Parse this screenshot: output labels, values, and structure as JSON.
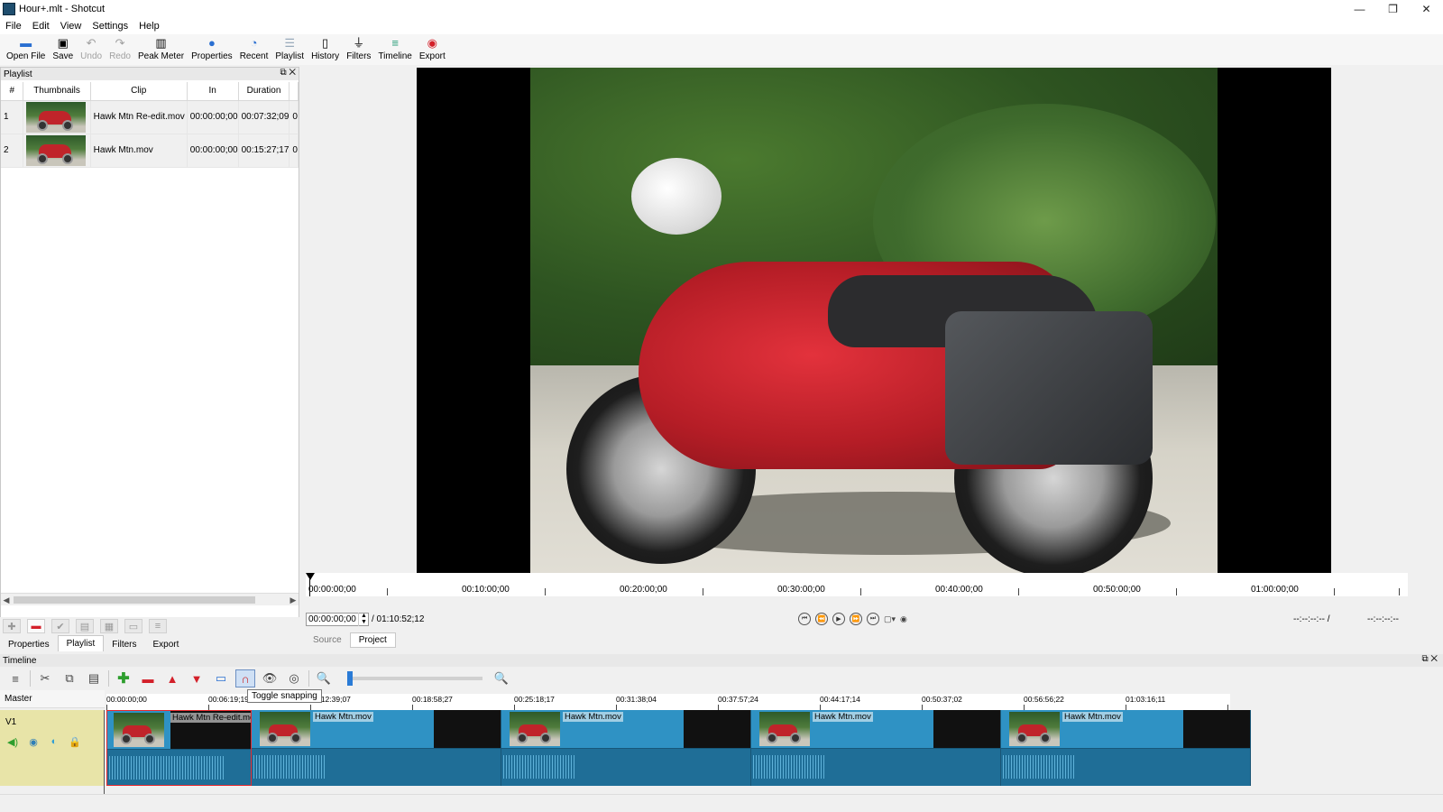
{
  "window": {
    "title": "Hour+.mlt - Shotcut",
    "controls": [
      "—",
      "❐",
      "✕"
    ]
  },
  "menu": [
    "File",
    "Edit",
    "View",
    "Settings",
    "Help"
  ],
  "toolbar": [
    {
      "label": "Open File",
      "icon": "folder-open-icon",
      "enabled": true
    },
    {
      "label": "Save",
      "icon": "save-icon",
      "enabled": true
    },
    {
      "label": "Undo",
      "icon": "undo-icon",
      "enabled": false
    },
    {
      "label": "Redo",
      "icon": "redo-icon",
      "enabled": false
    },
    {
      "label": "Peak Meter",
      "icon": "peak-meter-icon",
      "enabled": true
    },
    {
      "label": "Properties",
      "icon": "info-icon",
      "enabled": true
    },
    {
      "label": "Recent",
      "icon": "recent-icon",
      "enabled": true
    },
    {
      "label": "Playlist",
      "icon": "playlist-icon",
      "enabled": true
    },
    {
      "label": "History",
      "icon": "history-icon",
      "enabled": true
    },
    {
      "label": "Filters",
      "icon": "filters-icon",
      "enabled": true
    },
    {
      "label": "Timeline",
      "icon": "timeline-icon",
      "enabled": true
    },
    {
      "label": "Export",
      "icon": "export-icon",
      "enabled": true
    }
  ],
  "playlist": {
    "title": "Playlist",
    "columns": [
      "#",
      "Thumbnails",
      "Clip",
      "In",
      "Duration"
    ],
    "rows": [
      {
        "num": "1",
        "clip": "Hawk Mtn Re-edit.mov",
        "in": "00:00:00;00",
        "duration": "00:07:32;09",
        "extra": "0"
      },
      {
        "num": "2",
        "clip": "Hawk Mtn.mov",
        "in": "00:00:00;00",
        "duration": "00:15:27;17",
        "extra": "0"
      }
    ]
  },
  "dock_tabs": [
    "Properties",
    "Playlist",
    "Filters",
    "Export"
  ],
  "dock_tab_active": "Playlist",
  "viewer": {
    "ruler_labels": [
      "00:00:00;00",
      "00:10:00;00",
      "00:20:00;00",
      "00:30:00;00",
      "00:40:00;00",
      "00:50:00;00",
      "01:00:00;00"
    ],
    "timecode": "00:00:00;00",
    "total": "/ 01:10:52;12",
    "in_point": "--:--:--:-- /",
    "out_point": "--:--:--:--",
    "tabs": [
      "Source",
      "Project"
    ],
    "active_tab": "Project"
  },
  "timeline": {
    "title": "Timeline",
    "tooltip": "Toggle snapping",
    "master_label": "Master",
    "track_name": "V1",
    "ruler_labels": [
      "00:00:00;00",
      "00:06:19;19",
      "00:12:39;07",
      "00:18:58;27",
      "00:25:18;17",
      "00:31:38;04",
      "00:37:57;24",
      "00:44:17;14",
      "00:50:37;02",
      "00:56:56;22",
      "01:03:16;11"
    ],
    "clips": [
      {
        "name": "Hawk Mtn Re-edit.mov",
        "selected": true
      },
      {
        "name": "Hawk Mtn.mov",
        "selected": false
      },
      {
        "name": "Hawk Mtn.mov",
        "selected": false
      },
      {
        "name": "Hawk Mtn.mov",
        "selected": false
      },
      {
        "name": "Hawk Mtn.mov",
        "selected": false
      }
    ]
  },
  "colors": {
    "clip_video": "#2f92c4",
    "clip_audio": "#1f6e97",
    "track_head": "#e8e4a8",
    "selection": "#e8282d"
  }
}
